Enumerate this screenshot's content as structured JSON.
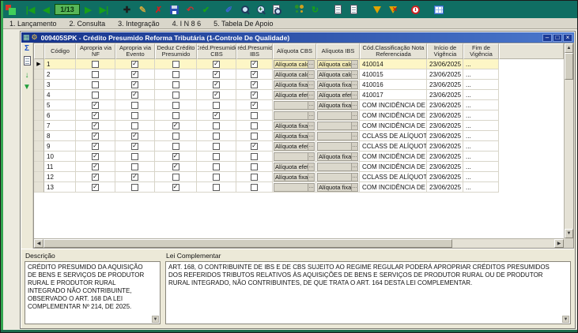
{
  "glyphs": {
    "up": "▲",
    "down": "▼",
    "left": "◀",
    "right": "▶"
  },
  "toolbar": {
    "buttons": [
      {
        "name": "first-record-button",
        "glyph": "|◀",
        "color": "#19a019"
      },
      {
        "name": "prior-record-button",
        "glyph": "◀",
        "color": "#19a019"
      },
      {
        "name": "record-counter",
        "label": "1/13",
        "counter": true
      },
      {
        "name": "next-record-button",
        "glyph": "▶",
        "color": "#19a019"
      },
      {
        "name": "last-record-button",
        "glyph": "▶|",
        "color": "#19a019"
      },
      {
        "sep": true
      },
      {
        "name": "insert-button",
        "glyph": "✚",
        "color": "#1d1d1d"
      },
      {
        "name": "edit-button",
        "glyph": "✎",
        "color": "#d2a73c"
      },
      {
        "name": "delete-button",
        "glyph": "✗",
        "color": "#cc2020"
      },
      {
        "name": "save-button",
        "css": "floppy"
      },
      {
        "name": "undo-button",
        "glyph": "↶",
        "color": "#cc3030"
      },
      {
        "name": "confirm-button",
        "glyph": "✔",
        "color": "#19a019"
      },
      {
        "sep": true
      },
      {
        "name": "brush-button",
        "glyph": "✐",
        "color": "#3a66cc"
      },
      {
        "name": "search-button",
        "css": "magnifier"
      },
      {
        "name": "advanced-search-button",
        "css": "magnifier-plus"
      },
      {
        "name": "preview-button",
        "css": "doc-magnifier"
      },
      {
        "sep": true
      },
      {
        "name": "users-button",
        "css": "people"
      },
      {
        "name": "refresh-button",
        "glyph": "↻",
        "color": "#19a019"
      },
      {
        "sep": true
      },
      {
        "name": "report-button",
        "css": "doc"
      },
      {
        "name": "log-button",
        "css": "doc"
      },
      {
        "sep": true
      },
      {
        "name": "filter-button",
        "css": "funnel"
      },
      {
        "name": "clear-filter-button",
        "css": "funnel-x"
      },
      {
        "sep": true
      },
      {
        "name": "info-button",
        "css": "info"
      },
      {
        "sep": true
      },
      {
        "name": "grid-config-button",
        "css": "grid"
      }
    ]
  },
  "menu": {
    "items": [
      {
        "label": "1. Lançamento"
      },
      {
        "label": "2. Consulta"
      },
      {
        "label": "3. Integração"
      },
      {
        "label": "4. I N 8 6"
      },
      {
        "label": "5. Tabela De Apoio"
      }
    ]
  },
  "window": {
    "title": "009405SPK - Crédito Presumido Reforma Tributária (1-Controle De Qualidade)",
    "icons": [
      {
        "name": "table-icon",
        "glyph": "▦",
        "color": "#9fe0b0"
      },
      {
        "name": "wrench-icon",
        "glyph": "⚙",
        "color": "#f2c94c"
      }
    ],
    "minimize_glyph": "–",
    "maximize_glyph": "□",
    "close_glyph": "×"
  },
  "side_toolbar": {
    "icons": [
      {
        "name": "sum-icon",
        "glyph": "Σ",
        "color": "#1a50c8"
      },
      {
        "name": "report-icon",
        "css": "doc"
      },
      {
        "name": "export-icon",
        "glyph": "↓",
        "color": "#1f9e3a"
      },
      {
        "name": "marker-icon",
        "glyph": "▼",
        "color": "#1f9e3a"
      }
    ]
  },
  "grid": {
    "selected_marker": "▶",
    "check_glyph": "✓",
    "ellipsis": "…",
    "columns": [
      {
        "key": "codigo",
        "label": "Código"
      },
      {
        "key": "nf",
        "label": "Apropria via NF"
      },
      {
        "key": "evento",
        "label": "Apropria via Evento"
      },
      {
        "key": "deduz",
        "label": "Deduz Crédito Presumido"
      },
      {
        "key": "cbs",
        "label": "Créd.Presumido CBS"
      },
      {
        "key": "ibs",
        "label": "Créd.Presumido IBS"
      },
      {
        "key": "aliquota_cbs",
        "label": "Alíquota CBS"
      },
      {
        "key": "aliquota_ibs",
        "label": "Alíquota IBS"
      },
      {
        "key": "classificacao",
        "label": "Cód.Classificação Nota Referenciada"
      },
      {
        "key": "inicio",
        "label": "Início de Vigência"
      },
      {
        "key": "fim",
        "label": "Fim de Vigência"
      }
    ],
    "rows": [
      {
        "codigo": "1",
        "selected": true,
        "nf": false,
        "evento": true,
        "deduz": false,
        "cbs": true,
        "ibs": true,
        "aliquota_cbs": "Alíquota calcu",
        "aliquota_ibs": "Alíquota calcu",
        "classificacao": "410014",
        "inicio": "23/06/2025",
        "fim": "..."
      },
      {
        "codigo": "2",
        "selected": false,
        "nf": false,
        "evento": true,
        "deduz": false,
        "cbs": true,
        "ibs": true,
        "aliquota_cbs": "Alíquota calcu",
        "aliquota_ibs": "Alíquota calcu",
        "classificacao": "410015",
        "inicio": "23/06/2025",
        "fim": "..."
      },
      {
        "codigo": "3",
        "selected": false,
        "nf": false,
        "evento": true,
        "deduz": false,
        "cbs": true,
        "ibs": true,
        "aliquota_cbs": "Alíquota fixa",
        "aliquota_ibs": "Alíquota fixa",
        "classificacao": "410016",
        "inicio": "23/06/2025",
        "fim": "..."
      },
      {
        "codigo": "4",
        "selected": false,
        "nf": false,
        "evento": true,
        "deduz": false,
        "cbs": true,
        "ibs": true,
        "aliquota_cbs": "Alíquota efet",
        "aliquota_ibs": "Alíquota efet",
        "classificacao": "410017",
        "inicio": "23/06/2025",
        "fim": "..."
      },
      {
        "codigo": "5",
        "selected": false,
        "nf": true,
        "evento": false,
        "deduz": false,
        "cbs": false,
        "ibs": true,
        "aliquota_cbs": "",
        "aliquota_ibs": "Alíquota fixa",
        "classificacao": "COM INCIDÊNCIA DE",
        "inicio": "23/06/2025",
        "fim": "..."
      },
      {
        "codigo": "6",
        "selected": false,
        "nf": true,
        "evento": false,
        "deduz": false,
        "cbs": true,
        "ibs": false,
        "aliquota_cbs": "",
        "aliquota_ibs": "",
        "classificacao": "COM INCIDÊNCIA DE",
        "inicio": "23/06/2025",
        "fim": "..."
      },
      {
        "codigo": "7",
        "selected": false,
        "nf": true,
        "evento": false,
        "deduz": true,
        "cbs": false,
        "ibs": false,
        "aliquota_cbs": "Alíquota fixa",
        "aliquota_ibs": "",
        "classificacao": "COM INCIDÊNCIA DE",
        "inicio": "23/06/2025",
        "fim": "..."
      },
      {
        "codigo": "8",
        "selected": false,
        "nf": true,
        "evento": true,
        "deduz": false,
        "cbs": false,
        "ibs": false,
        "aliquota_cbs": "Alíquota fixa",
        "aliquota_ibs": "",
        "classificacao": "CCLASS DE ALÍQUOTA",
        "inicio": "23/06/2025",
        "fim": "..."
      },
      {
        "codigo": "9",
        "selected": false,
        "nf": true,
        "evento": true,
        "deduz": false,
        "cbs": false,
        "ibs": true,
        "aliquota_cbs": "Alíquota efet",
        "aliquota_ibs": "",
        "classificacao": "CCLASS DE ALÍQUOTA",
        "inicio": "23/06/2025",
        "fim": "..."
      },
      {
        "codigo": "10",
        "selected": false,
        "nf": true,
        "evento": false,
        "deduz": true,
        "cbs": false,
        "ibs": false,
        "aliquota_cbs": "",
        "aliquota_ibs": "Alíquota fixa",
        "classificacao": "COM INCIDÊNCIA DE",
        "inicio": "23/06/2025",
        "fim": "..."
      },
      {
        "codigo": "11",
        "selected": false,
        "nf": true,
        "evento": false,
        "deduz": true,
        "cbs": false,
        "ibs": false,
        "aliquota_cbs": "Alíquota efet",
        "aliquota_ibs": "",
        "classificacao": "COM INCIDÊNCIA DE",
        "inicio": "23/06/2025",
        "fim": "..."
      },
      {
        "codigo": "12",
        "selected": false,
        "nf": true,
        "evento": true,
        "deduz": false,
        "cbs": false,
        "ibs": false,
        "aliquota_cbs": "Alíquota fixa",
        "aliquota_ibs": "",
        "classificacao": "CCLASS DE ALÍQUOTA",
        "inicio": "23/06/2025",
        "fim": "..."
      },
      {
        "codigo": "13",
        "selected": false,
        "nf": true,
        "evento": false,
        "deduz": true,
        "cbs": false,
        "ibs": false,
        "aliquota_cbs": "",
        "aliquota_ibs": "Alíquota fixa",
        "classificacao": "COM INCIDÊNCIA DE",
        "inicio": "23/06/2025",
        "fim": "..."
      }
    ]
  },
  "panels": {
    "descricao_label": "Descrição",
    "descricao_text": "CRÉDITO PRESUMIDO DA AQUISIÇÃO DE BENS E SERVIÇOS DE PRODUTOR RURAL E PRODUTOR RURAL INTEGRADO NÃO CONTRIBUINTE, OBSERVADO O ART. 168 DA LEI COMPLEMENTAR Nº 214, DE 2025.",
    "lei_label": "Lei Complementar",
    "lei_text": "ART. 168, O CONTRIBUINTE DE IBS E DE CBS SUJEITO AO REGIME REGULAR PODERÁ APROPRIAR CRÉDITOS PRESUMIDOS DOS REFERIDOS TRIBUTOS RELATIVOS ÀS AQUISIÇÕES DE BENS E SERVIÇOS DE PRODUTOR RURAL OU DE PRODUTOR RURAL INTEGRADO, NÃO CONTRIBUINTES, DE QUE TRATA O ART. 164 DESTA LEI COMPLEMENTAR."
  }
}
